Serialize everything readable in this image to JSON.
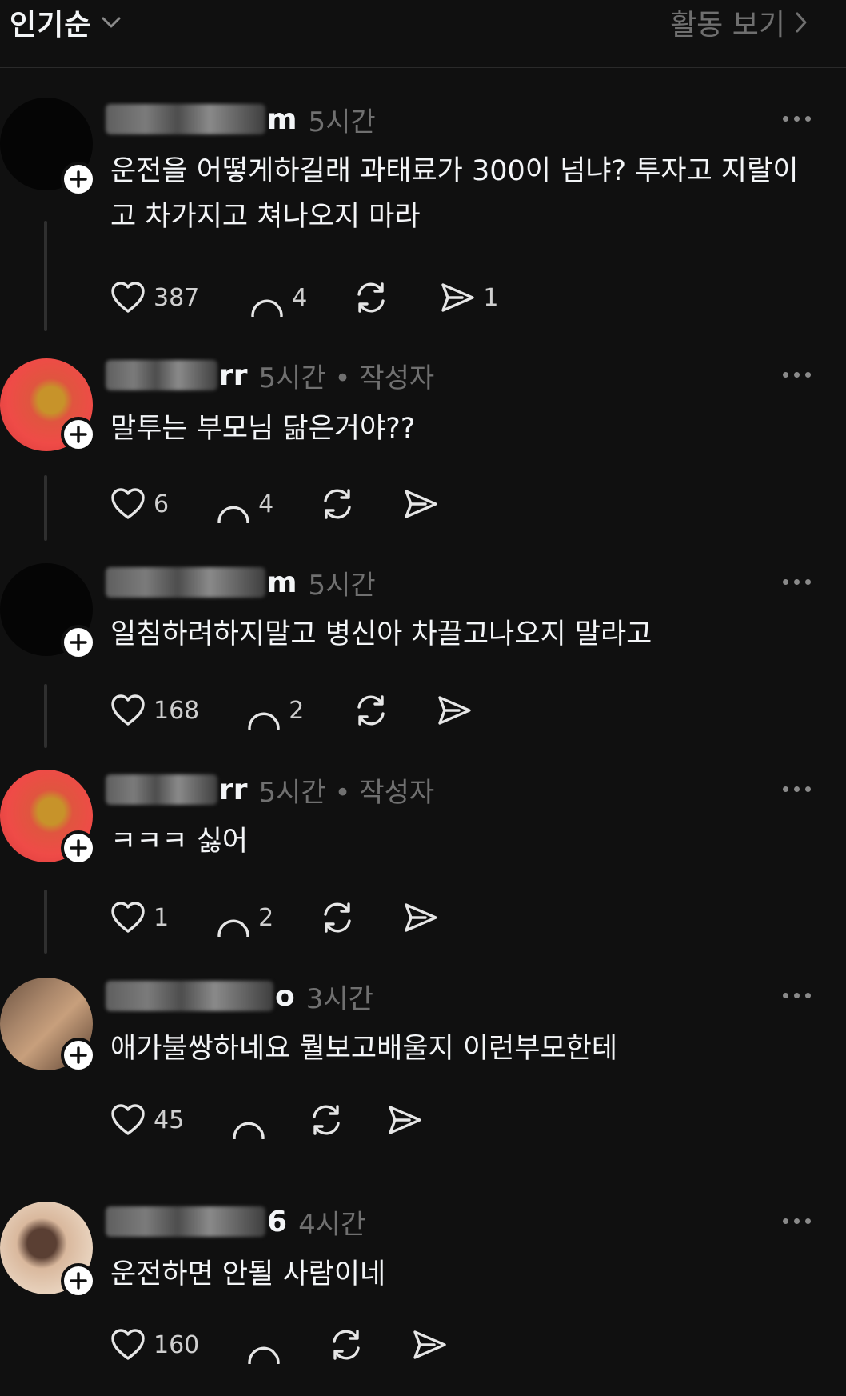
{
  "header": {
    "sort_label": "인기순",
    "activity_label": "활동 보기"
  },
  "comments": [
    {
      "name_tail": "m",
      "time": "5시간",
      "text": "운전을 어떻게하길래 과태료가 300이 넘냐? 투자고 지랄이고 차가지고 쳐나오지 마라",
      "likes": "387",
      "replies": "4",
      "shares": "1"
    },
    {
      "name_tail": "rr",
      "time": "5시간 • 작성자",
      "text": "말투는 부모님 닮은거야??",
      "likes": "6",
      "replies": "4",
      "shares": ""
    },
    {
      "name_tail": "m",
      "time": "5시간",
      "text": "일침하려하지말고 병신아 차끌고나오지 말라고",
      "likes": "168",
      "replies": "2",
      "shares": ""
    },
    {
      "name_tail": "rr",
      "time": "5시간 • 작성자",
      "text": "ㅋㅋㅋ 싫어",
      "likes": "1",
      "replies": "2",
      "shares": ""
    },
    {
      "name_tail": "o",
      "time": "3시간",
      "text": "애가불쌍하네요 뭘보고배울지 이런부모한테",
      "likes": "45",
      "replies": "",
      "shares": ""
    },
    {
      "name_tail": "6",
      "time": "4시간",
      "text": "운전하면 안될 사람이네",
      "likes": "160",
      "replies": "",
      "shares": ""
    }
  ],
  "icons": {
    "sort": "chevron-down-icon",
    "activity": "chevron-right-icon",
    "more": "more-icon",
    "like": "heart-icon",
    "reply": "comment-icon",
    "repost": "repost-icon",
    "share": "send-icon",
    "follow": "plus-icon"
  },
  "colors": {
    "background": "#101010",
    "text": "#f3f5f7",
    "secondary": "#707070"
  }
}
